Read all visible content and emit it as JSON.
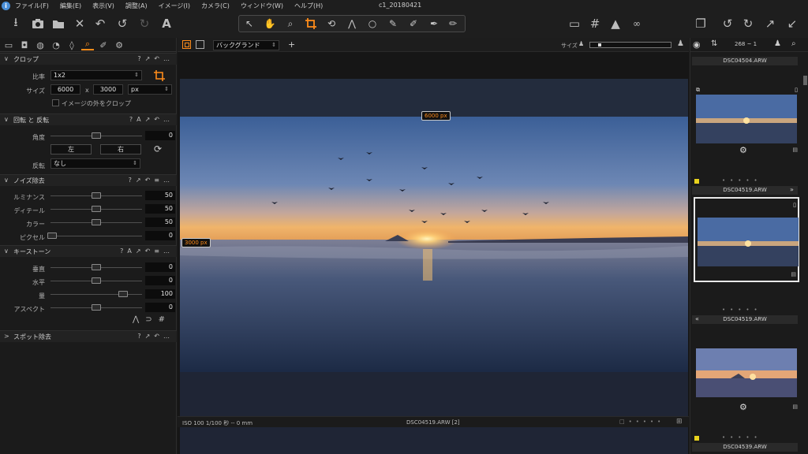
{
  "app": {
    "title": "c1_20180421",
    "menu": [
      "ファイル(F)",
      "編集(E)",
      "表示(V)",
      "調整(A)",
      "イメージ(I)",
      "カメラ(C)",
      "ウィンドウ(W)",
      "ヘルプ(H)"
    ]
  },
  "toolbar": {
    "left_icons": [
      "import-icon",
      "camera-icon",
      "folder-icon",
      "close-icon",
      "undo-icon",
      "undo-step-icon",
      "redo-icon",
      "text-icon"
    ],
    "right_icons": [
      "edit-icon",
      "grid-icon",
      "warning-icon",
      "glasses-icon",
      "copy-icon",
      "rotate-left-icon",
      "rotate-right-icon",
      "expand-icon",
      "collapse-icon"
    ]
  },
  "crop": {
    "title": "クロップ",
    "ratio_label": "比率",
    "ratio_value": "1x2",
    "size_label": "サイズ",
    "width": "6000",
    "x_label": "x",
    "height": "3000",
    "unit": "px",
    "outside_label": "イメージの外をクロップ"
  },
  "rotation": {
    "title": "回転 と 反転",
    "angle_label": "角度",
    "angle_value": "0",
    "left_button": "左",
    "right_button": "右",
    "flip_label": "反転",
    "flip_value": "なし"
  },
  "noise": {
    "title": "ノイズ除去",
    "rows": [
      {
        "label": "ルミナンス",
        "value": "50"
      },
      {
        "label": "ディテール",
        "value": "50"
      },
      {
        "label": "カラー",
        "value": "50"
      },
      {
        "label": "ピクセル",
        "value": "0"
      }
    ]
  },
  "keystone": {
    "title": "キーストーン",
    "rows": [
      {
        "label": "垂直",
        "value": "0"
      },
      {
        "label": "水平",
        "value": "0"
      },
      {
        "label": "量",
        "value": "100"
      },
      {
        "label": "アスペクト",
        "value": "0"
      }
    ]
  },
  "spot": {
    "title": "スポット除去"
  },
  "viewer": {
    "background_dropdown": "バックグランド",
    "size_label": "サイズ",
    "crop_width_label": "6000 px",
    "crop_height_label": "3000 px",
    "status_left": "ISO 100  1/100 秒  --  0 mm",
    "status_center": "DSC04519.ARW [2]"
  },
  "browser": {
    "count": "268 ~ 1",
    "thumbs": [
      {
        "name": "DSC04504.ARW"
      },
      {
        "name": "DSC04519.ARW"
      },
      {
        "name": "DSC04519.ARW"
      },
      {
        "name": "DSC04539.ARW"
      }
    ]
  },
  "colors": {
    "accent": "#ff8c1a",
    "yellow_tag": "#e8d21d"
  }
}
